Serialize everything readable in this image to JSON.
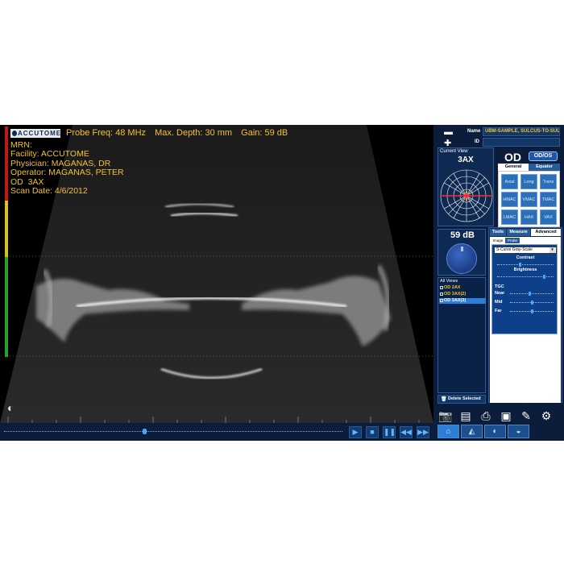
{
  "header": {
    "logo": "ACCUTOME",
    "probe_freq": "Probe Freq: 48 MHz",
    "max_depth": "Max. Depth: 30 mm",
    "gain": "Gain: 59 dB"
  },
  "patient": {
    "mrn": "MRN:",
    "facility": "Facility: ACCUTOME",
    "physician": "Physician: MAGANAS, DR",
    "operator": "Operator: MAGANAS, PETER",
    "eye_view": "OD  3AX",
    "scan_date": "Scan Date: 4/6/2012"
  },
  "playback": {
    "progress": 0.41,
    "buttons": [
      "▶",
      "■",
      "❚❚",
      "◀◀",
      "▶▶"
    ]
  },
  "right_panel": {
    "name_label": "Name",
    "name_value": "UBM-SAMPLE, SULCUS-TO-SULC",
    "id_label": "ID",
    "id_value": "",
    "current_view_title": "Current View",
    "current_view": "3AX",
    "eye": "OD",
    "eye_toggle": "OD/OS",
    "view_tabs": [
      "General",
      "Equator"
    ],
    "view_buttons": [
      "Axial",
      "Long",
      "Trans",
      "HMAC",
      "VMAC",
      "TMAC",
      "LMAC",
      "HAX",
      "VAX"
    ],
    "gain_value": "59 dB",
    "all_views_title": "All Views",
    "views": [
      "OD 2AX",
      "OD 3AX(2)",
      "OD 3AX(3)"
    ],
    "selected_view_index": 2,
    "delete_label": "Delete Selected",
    "tool_tabs": [
      "Tools",
      "Measure",
      "Advanced"
    ],
    "sub_tabs": [
      "Image",
      "Probe"
    ],
    "curve_select": "S-Curve Gray-Scale",
    "contrast_label": "Contrast",
    "brightness_label": "Brightness",
    "contrast_level": 0.4,
    "brightness_level": 0.85,
    "tgc_label": "TGC",
    "tgc": [
      {
        "label": "Near",
        "level": 0.45
      },
      {
        "label": "Mid",
        "level": 0.5
      },
      {
        "label": "Far",
        "level": 0.5
      }
    ]
  },
  "icons": {
    "folder": "folder-icon",
    "add_patient": "add-patient-icon",
    "camera": "camera-icon",
    "report": "report-icon",
    "print": "print-icon",
    "save": "save-icon",
    "pen": "pen-icon",
    "settings": "gear-icon"
  },
  "colors": {
    "overlay_text": "#f2c233",
    "panel_bg": "#0b1d3b",
    "accent": "#2c7ed6"
  }
}
